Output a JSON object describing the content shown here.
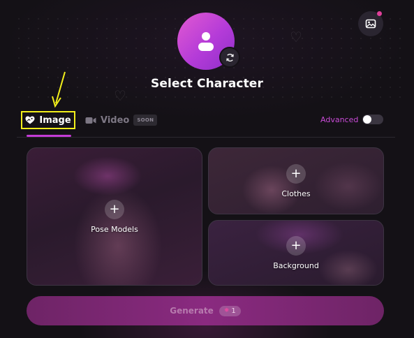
{
  "header": {
    "title": "Select Character"
  },
  "tabs": [
    {
      "label": "Image",
      "icon": "heart-image-icon",
      "active": true
    },
    {
      "label": "Video",
      "icon": "video-camera-icon",
      "badge": "SOON"
    }
  ],
  "advanced": {
    "label": "Advanced",
    "enabled": false
  },
  "cards": {
    "pose": {
      "label": "Pose Models",
      "icon": "plus-icon"
    },
    "clothes": {
      "label": "Clothes",
      "icon": "plus-icon"
    },
    "background": {
      "label": "Background",
      "icon": "plus-icon"
    }
  },
  "generate": {
    "label": "Generate",
    "cost": "1",
    "cost_icon": "gem-icon"
  },
  "colors": {
    "accent": "#c43bd6",
    "highlight_box": "#f2ef1b",
    "notification_dot": "#e0409a"
  }
}
